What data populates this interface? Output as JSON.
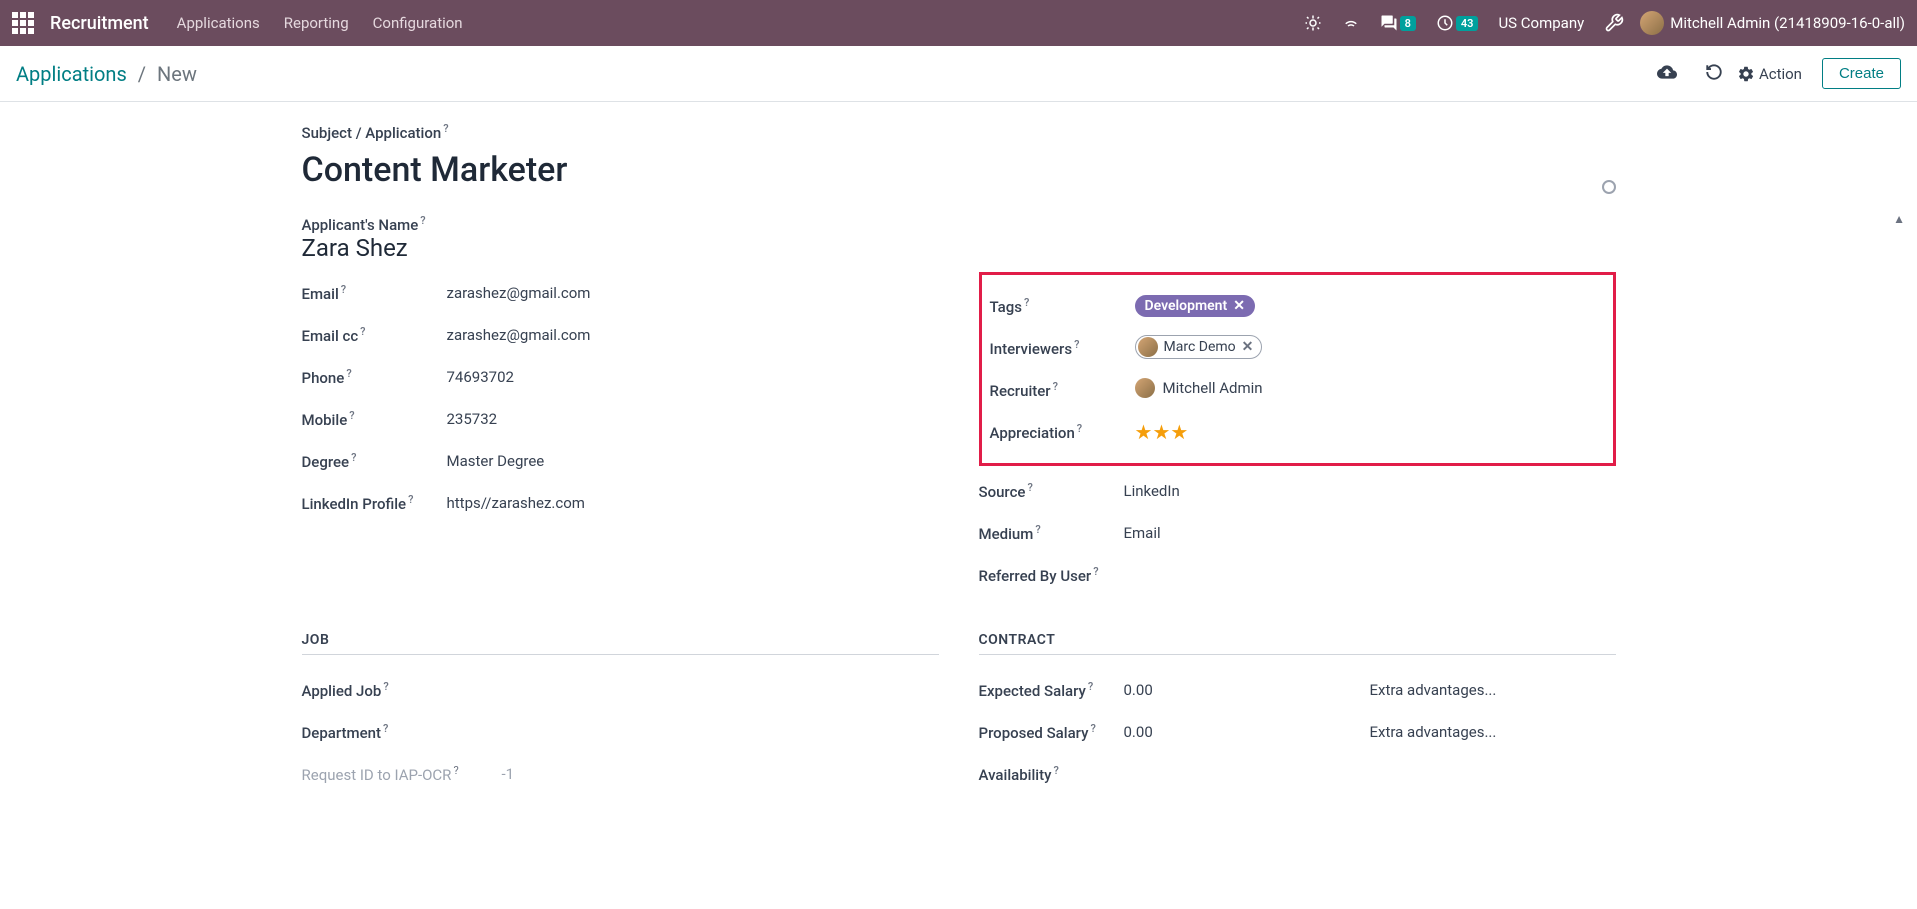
{
  "topbar": {
    "app_title": "Recruitment",
    "nav": [
      "Applications",
      "Reporting",
      "Configuration"
    ],
    "messages_badge": "8",
    "activities_badge": "43",
    "company": "US Company",
    "user": "Mitchell Admin (21418909-16-0-all)"
  },
  "subbar": {
    "breadcrumb_root": "Applications",
    "breadcrumb_current": "New",
    "action_label": "Action",
    "create_label": "Create"
  },
  "form": {
    "subject_label": "Subject / Application",
    "subject_value": "Content Marketer",
    "name_label": "Applicant's Name",
    "name_value": "Zara Shez",
    "left": {
      "email": {
        "label": "Email",
        "value": "zarashez@gmail.com"
      },
      "email_cc": {
        "label": "Email cc",
        "value": "zarashez@gmail.com"
      },
      "phone": {
        "label": "Phone",
        "value": "74693702"
      },
      "mobile": {
        "label": "Mobile",
        "value": "235732"
      },
      "degree": {
        "label": "Degree",
        "value": "Master Degree"
      },
      "linkedin": {
        "label": "LinkedIn Profile",
        "value": "https//zarashez.com"
      }
    },
    "right": {
      "tags": {
        "label": "Tags",
        "items": [
          "Development"
        ]
      },
      "interviewers": {
        "label": "Interviewers",
        "items": [
          "Marc Demo"
        ]
      },
      "recruiter": {
        "label": "Recruiter",
        "value": "Mitchell Admin"
      },
      "appreciation": {
        "label": "Appreciation",
        "stars": 3
      },
      "source": {
        "label": "Source",
        "value": "LinkedIn"
      },
      "medium": {
        "label": "Medium",
        "value": "Email"
      },
      "referred": {
        "label": "Referred By User",
        "value": ""
      }
    },
    "job_section": "JOB",
    "contract_section": "CONTRACT",
    "applied_job": {
      "label": "Applied Job",
      "value": ""
    },
    "department": {
      "label": "Department",
      "value": ""
    },
    "request_id": {
      "label": "Request ID to IAP-OCR",
      "value": "-1"
    },
    "expected_salary": {
      "label": "Expected Salary",
      "value": "0.00",
      "placeholder": "Extra advantages..."
    },
    "proposed_salary": {
      "label": "Proposed Salary",
      "value": "0.00",
      "placeholder": "Extra advantages..."
    },
    "availability": {
      "label": "Availability",
      "value": ""
    }
  }
}
